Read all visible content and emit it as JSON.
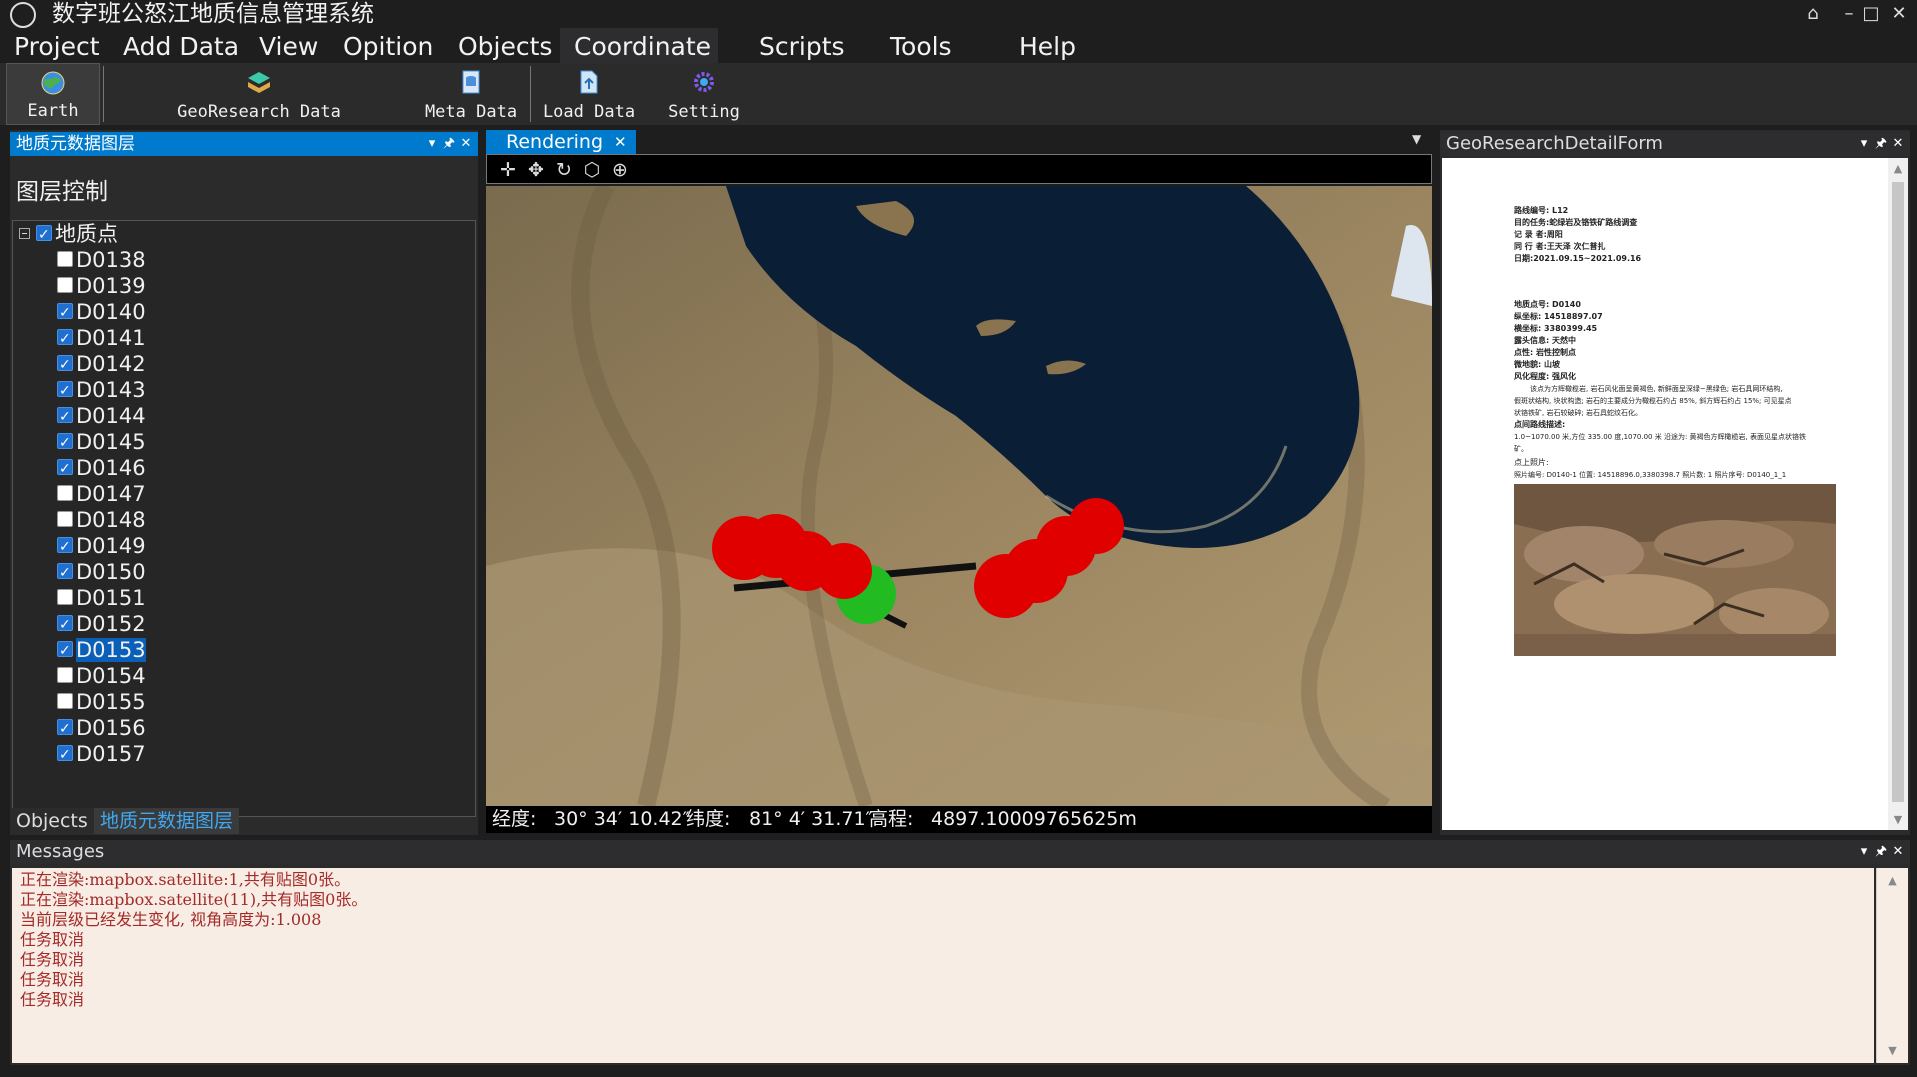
{
  "app": {
    "title": "数字班公怒江地质信息管理系统",
    "window_controls": [
      "restore-icon",
      "minimize-icon",
      "maximize-icon",
      "close-icon"
    ]
  },
  "menu": [
    "Project",
    "Add Data",
    "View",
    "Opition",
    "Objects",
    "Coordinate",
    "Scripts",
    "Tools",
    "Help"
  ],
  "toolbar": {
    "earth": "Earth",
    "georesearch": "GeoResearch Data",
    "metadata": "Meta Data",
    "loaddata": "Load Data",
    "setting": "Setting"
  },
  "left_panel": {
    "header": "地质元数据图层",
    "title": "图层控制",
    "root": "地质点",
    "items": [
      {
        "label": "D0138",
        "checked": false
      },
      {
        "label": "D0139",
        "checked": false
      },
      {
        "label": "D0140",
        "checked": true
      },
      {
        "label": "D0141",
        "checked": true
      },
      {
        "label": "D0142",
        "checked": true
      },
      {
        "label": "D0143",
        "checked": true
      },
      {
        "label": "D0144",
        "checked": true
      },
      {
        "label": "D0145",
        "checked": true
      },
      {
        "label": "D0146",
        "checked": true
      },
      {
        "label": "D0147",
        "checked": false
      },
      {
        "label": "D0148",
        "checked": false
      },
      {
        "label": "D0149",
        "checked": true
      },
      {
        "label": "D0150",
        "checked": true
      },
      {
        "label": "D0151",
        "checked": false
      },
      {
        "label": "D0152",
        "checked": true
      },
      {
        "label": "D0153",
        "checked": true,
        "selected": true
      },
      {
        "label": "D0154",
        "checked": false
      },
      {
        "label": "D0155",
        "checked": false
      },
      {
        "label": "D0156",
        "checked": true
      },
      {
        "label": "D0157",
        "checked": true
      }
    ],
    "tabs": [
      "Objects",
      "地质元数据图层"
    ]
  },
  "center": {
    "tab": "Rendering",
    "nav_icons": [
      "pan-icon",
      "move-icon",
      "rotate-icon",
      "globe-3d-icon",
      "target-icon"
    ],
    "status": {
      "lon_label": "经度:",
      "lon": "30° 34′ 10.42″",
      "lat_label": "纬度:",
      "lat": "81° 4′ 31.71″",
      "elev_label": "高程:",
      "elev": "4897.10009765625m"
    }
  },
  "right_panel": {
    "header": "GeoResearchDetailForm",
    "doc": {
      "head": [
        "路线编号: L12",
        "目的任务:蛇绿岩及铬铁矿路线调查",
        "记  录  者:周阳",
        "同  行  者:王天泽  次仁普扎",
        "日期:2021.09.15~2021.09.16"
      ],
      "point": [
        "地质点号: D0140",
        "纵坐标: 14518897.07",
        "横坐标: 3380399.45",
        "露头信息: 天然中",
        "点性: 岩性控制点",
        "微地貌: 山坡",
        "风化程度: 强风化"
      ],
      "desc": [
        "该点为方辉橄榄岩, 岩石风化面呈黄褐色, 新鲜面呈深绿~黑绿色; 岩石具网环结构,",
        "假斑状结构, 块状构造; 岩石的主要成分为橄榄石约占 85%, 斜方辉石约占 15%; 可见星点",
        "状铬铁矿, 岩石较破碎; 岩石具蛇纹石化。"
      ],
      "route_title": "点间路线描述:",
      "route": [
        "1.0~1070.00 米,方位 335.00 度,1070.00 米    沿途为: 黄褐色方辉橄榄岩, 表面见星点状铬铁",
        "矿。"
      ],
      "photo_title": "点上照片:",
      "photo_info": "照片编号: D0140-1 位置: 14518896.0,3380398.7   照片数: 1 照片序号: D0140_1_1"
    }
  },
  "messages": {
    "header": "Messages",
    "lines": [
      "正在渲染:mapbox.satellite:1,共有贴图0张。",
      "正在渲染:mapbox.satellite(11),共有贴图0张。",
      "当前层级已经发生变化, 视角高度为:1.008",
      "任务取消",
      "任务取消",
      "任务取消",
      "任务取消"
    ]
  },
  "colors": {
    "accent": "#007acc",
    "marker_red": "#e00000",
    "marker_green": "#22bb22",
    "message_text": "#a52a2a"
  }
}
